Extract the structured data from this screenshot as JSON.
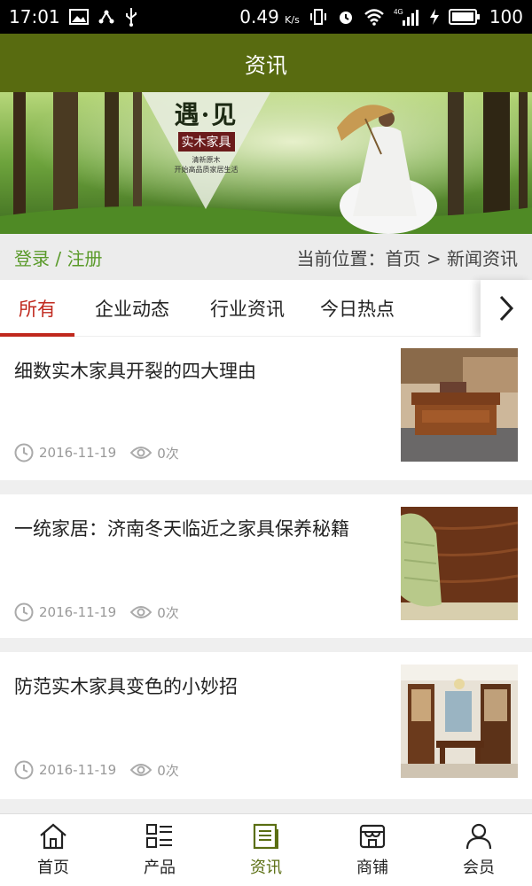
{
  "status_bar": {
    "time": "17:01",
    "speed": "0.49",
    "speed_unit": "K/s",
    "network": "4G",
    "battery": "100"
  },
  "header": {
    "title": "资讯"
  },
  "banner": {
    "title": "遇·见",
    "subtitle": "实木家具",
    "line1": "清新原木",
    "line2": "开始高品质家居生活"
  },
  "location_bar": {
    "login_link": "登录 / 注册",
    "breadcrumb": "当前位置：首页 > 新闻资讯"
  },
  "tabs": [
    {
      "label": "所有",
      "active": true
    },
    {
      "label": "企业动态"
    },
    {
      "label": "行业资讯"
    },
    {
      "label": "今日热点"
    }
  ],
  "news": [
    {
      "title": "细数实木家具开裂的四大理由",
      "date": "2016-11-19",
      "views": "0次",
      "thumb_icon": "coffee-table-photo"
    },
    {
      "title": "一统家居：济南冬天临近之家具保养秘籍",
      "date": "2016-11-19",
      "views": "0次",
      "thumb_icon": "wood-cleaning-photo"
    },
    {
      "title": "防范实木家具变色的小妙招",
      "date": "2016-11-19",
      "views": "0次",
      "thumb_icon": "dining-room-photo"
    }
  ],
  "bottom_nav": [
    {
      "label": "首页",
      "icon": "home-icon"
    },
    {
      "label": "产品",
      "icon": "grid-list-icon"
    },
    {
      "label": "资讯",
      "icon": "news-icon",
      "active": true
    },
    {
      "label": "商铺",
      "icon": "shop-icon"
    },
    {
      "label": "会员",
      "icon": "user-icon"
    }
  ],
  "colors": {
    "header_bg": "#586b10",
    "active_tab": "#c0281d",
    "login_link": "#5a9a2a",
    "nav_active": "#5a6e12"
  }
}
